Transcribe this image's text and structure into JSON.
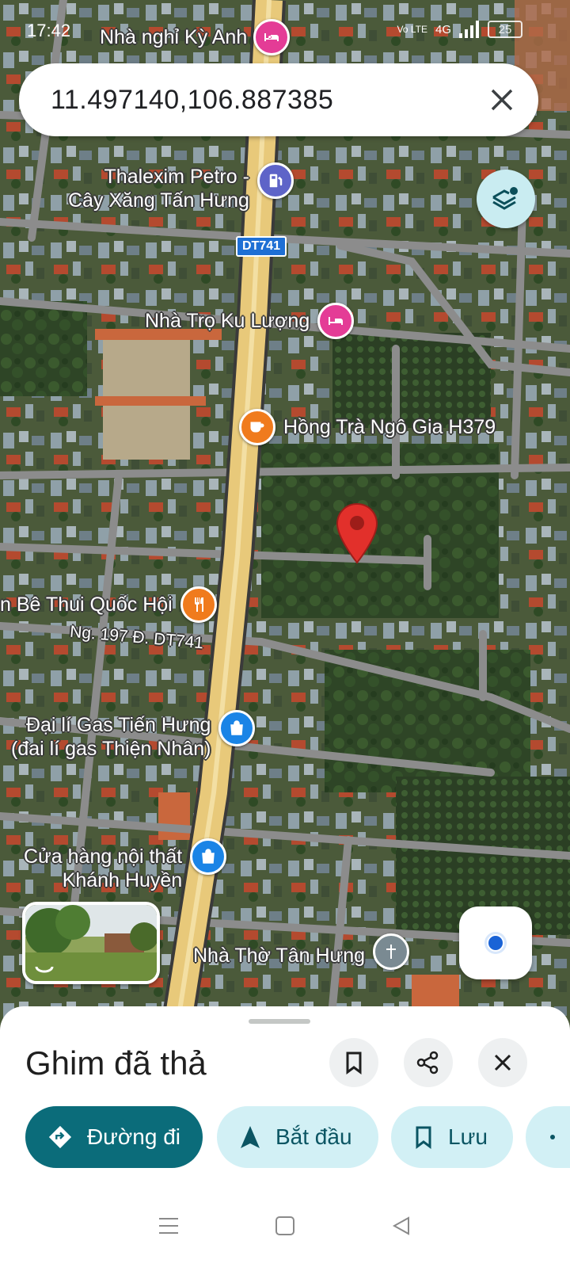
{
  "status_bar": {
    "time": "17:42",
    "network": "4G",
    "volte": "Vo LTE",
    "battery": "25"
  },
  "search": {
    "query": "11.497140,106.887385"
  },
  "map": {
    "road_shield": "DT741",
    "street_label": "Ng. 197 Đ. DT741",
    "pois": [
      {
        "label": "Nhà nghỉ Kỳ Anh",
        "icon": "bed-icon",
        "color": "#e43c96"
      },
      {
        "label": "Thalexim Petro -\nCây Xăng Tấn Hưng",
        "icon": "gas-pump-icon",
        "color": "#5e64c8"
      },
      {
        "label": "Nhà Trọ Ku Lượng",
        "icon": "bed-icon",
        "color": "#e43c96"
      },
      {
        "label": "Hồng Trà Ngô Gia H379",
        "icon": "coffee-cup-icon",
        "color": "#f07b1d"
      },
      {
        "label": "n Bê Thui Quốc Hội",
        "icon": "fork-knife-icon",
        "color": "#f07b1d"
      },
      {
        "label": "Đại lí Gas Tiến Hưng\n(đai lí gas Thiện Nhân)",
        "icon": "shopping-bag-icon",
        "color": "#1a84e6"
      },
      {
        "label": "Cửa hàng nội thất\nKhánh Huyền",
        "icon": "shopping-bag-icon",
        "color": "#1a84e6"
      },
      {
        "label": "Nhà Thờ Tân Hưng",
        "icon": "cross-icon",
        "color": "#7a8a92"
      }
    ],
    "pin_color": "#e2302b"
  },
  "sheet": {
    "title": "Ghim đã thả",
    "actions": [
      {
        "label": "Đường đi",
        "icon": "directions-icon"
      },
      {
        "label": "Bắt đầu",
        "icon": "navigation-arrow-icon"
      },
      {
        "label": "Lưu",
        "icon": "bookmark-icon"
      }
    ]
  },
  "colors": {
    "primary_teal": "#0b6c7a",
    "chip_light": "#d2f0f5",
    "road_main": "#e8c97a"
  }
}
